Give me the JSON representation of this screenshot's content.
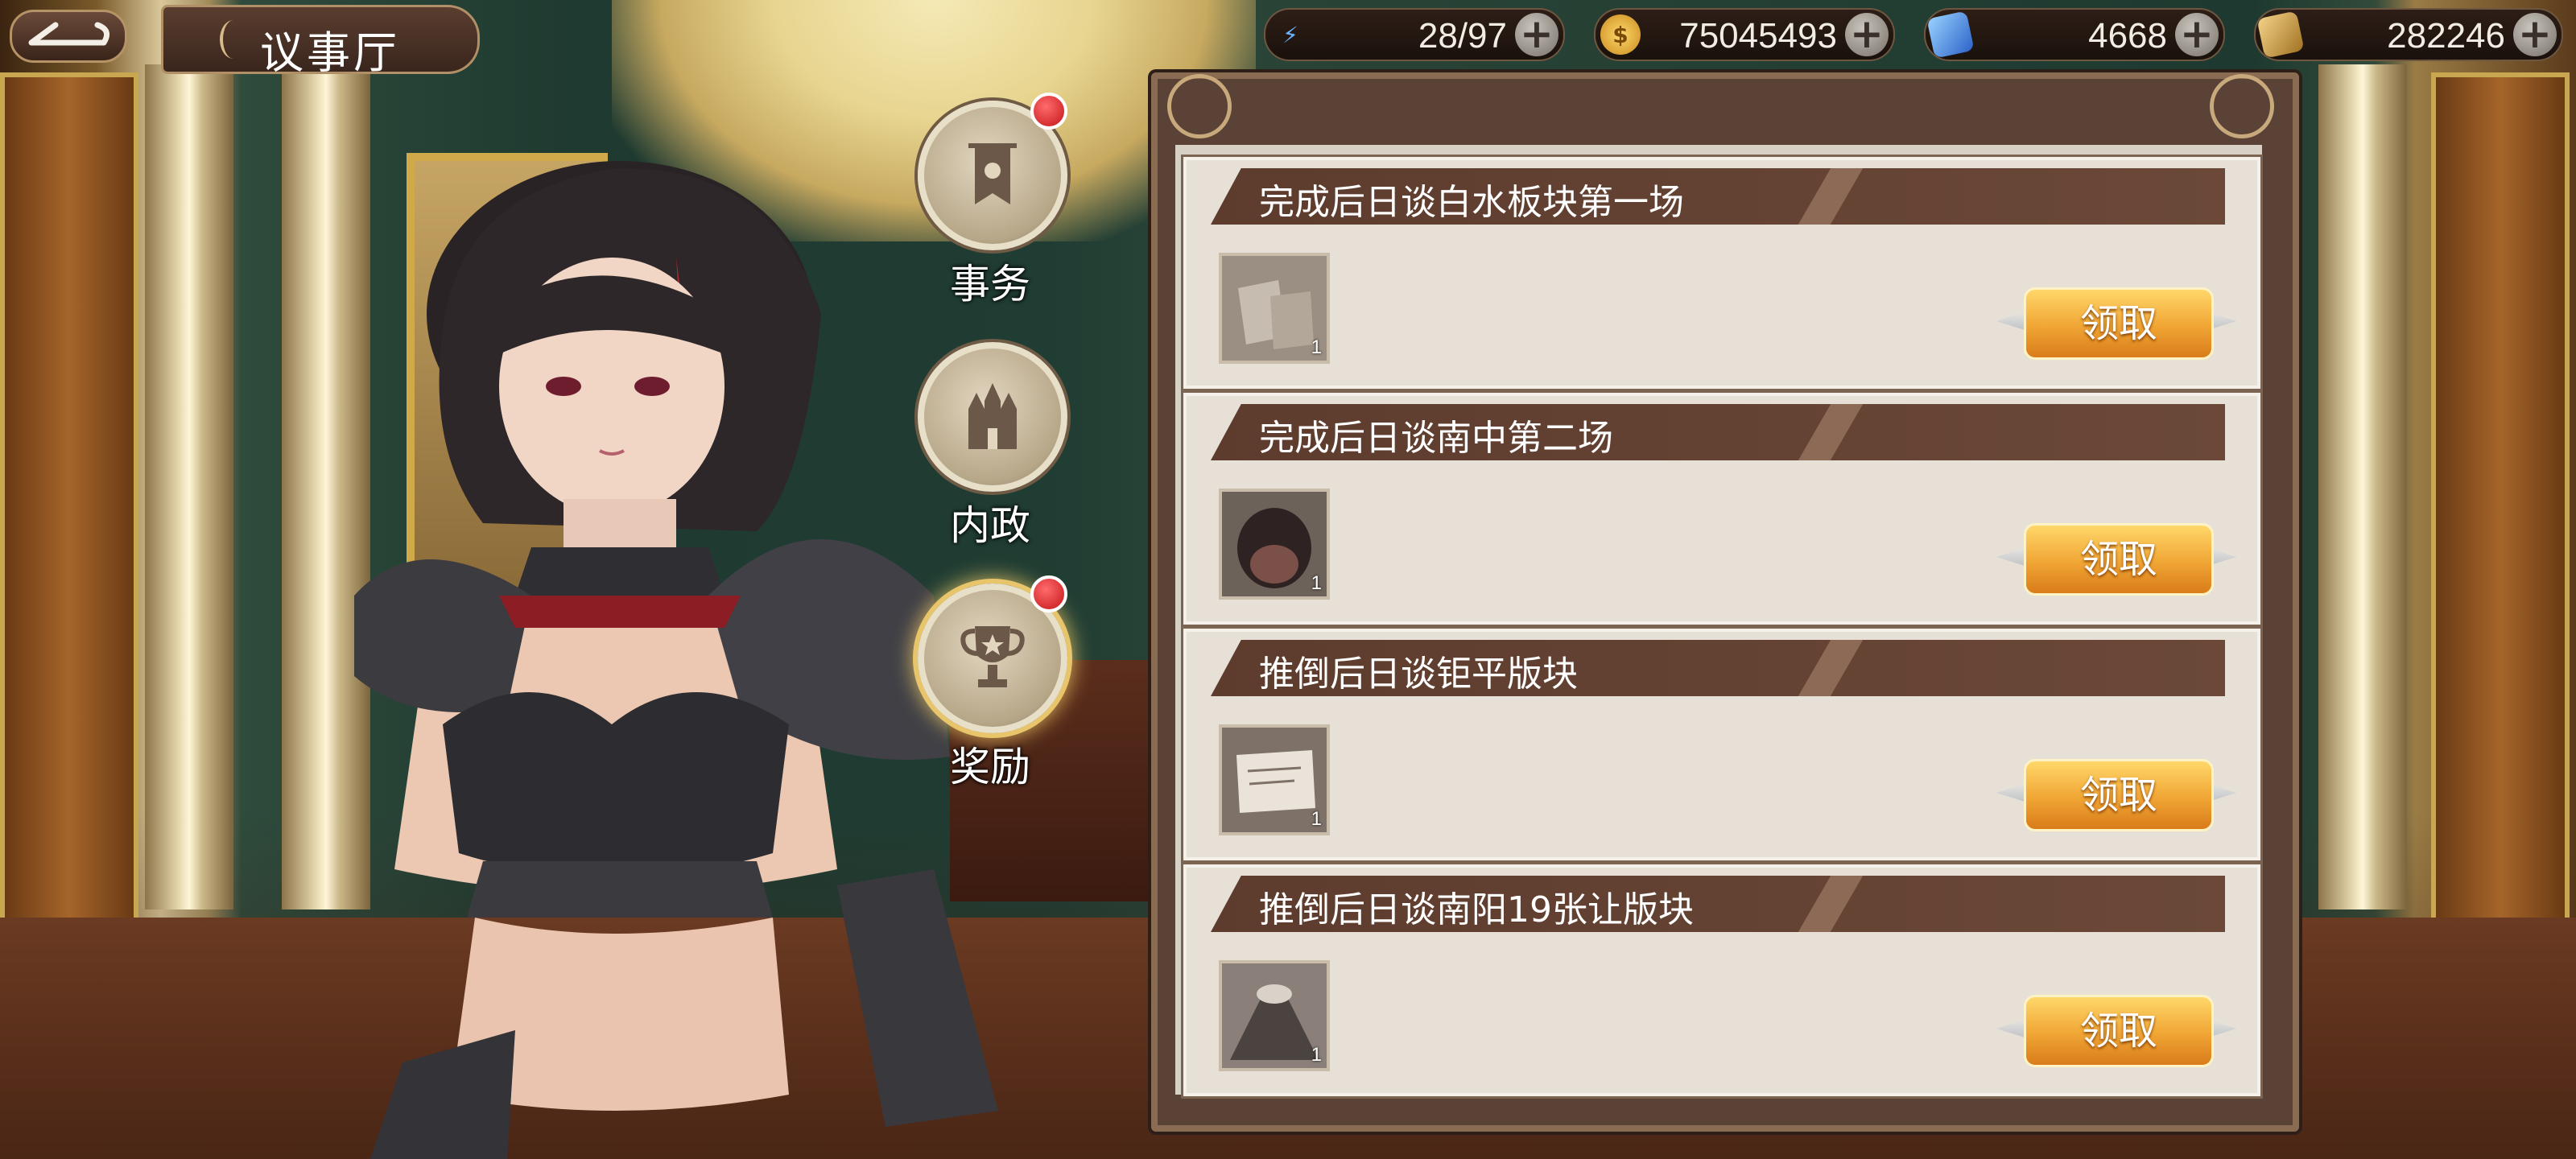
{
  "header": {
    "title": "议事厅",
    "back_icon": "back-arrow-icon"
  },
  "resources": [
    {
      "name": "stamina",
      "icon": "lightning-icon",
      "value": "28/97",
      "color": "#5aa7ff"
    },
    {
      "name": "gold",
      "icon": "gold-coin-icon",
      "value": "75045493",
      "color": "#e7b23a"
    },
    {
      "name": "gem",
      "icon": "blue-crystal-icon",
      "value": "4668",
      "color": "#3b7be8"
    },
    {
      "name": "token",
      "icon": "gold-token-icon",
      "value": "282246",
      "color": "#c9962e"
    }
  ],
  "nav": [
    {
      "label": "事务",
      "icon": "banner-icon",
      "badge": true,
      "active": false
    },
    {
      "label": "内政",
      "icon": "castle-icon",
      "badge": false,
      "active": false
    },
    {
      "label": "奖励",
      "icon": "trophy-icon",
      "badge": true,
      "active": true
    }
  ],
  "tasks": [
    {
      "name": "完成后日谈白水板块第一场",
      "reward_count": "1",
      "claim_label": "领取"
    },
    {
      "name": "完成后日谈南中第二场",
      "reward_count": "1",
      "claim_label": "领取"
    },
    {
      "name": "推倒后日谈钜平版块",
      "reward_count": "1",
      "claim_label": "领取"
    },
    {
      "name": "推倒后日谈南阳19张让版块",
      "reward_count": "1",
      "claim_label": "领取"
    }
  ]
}
